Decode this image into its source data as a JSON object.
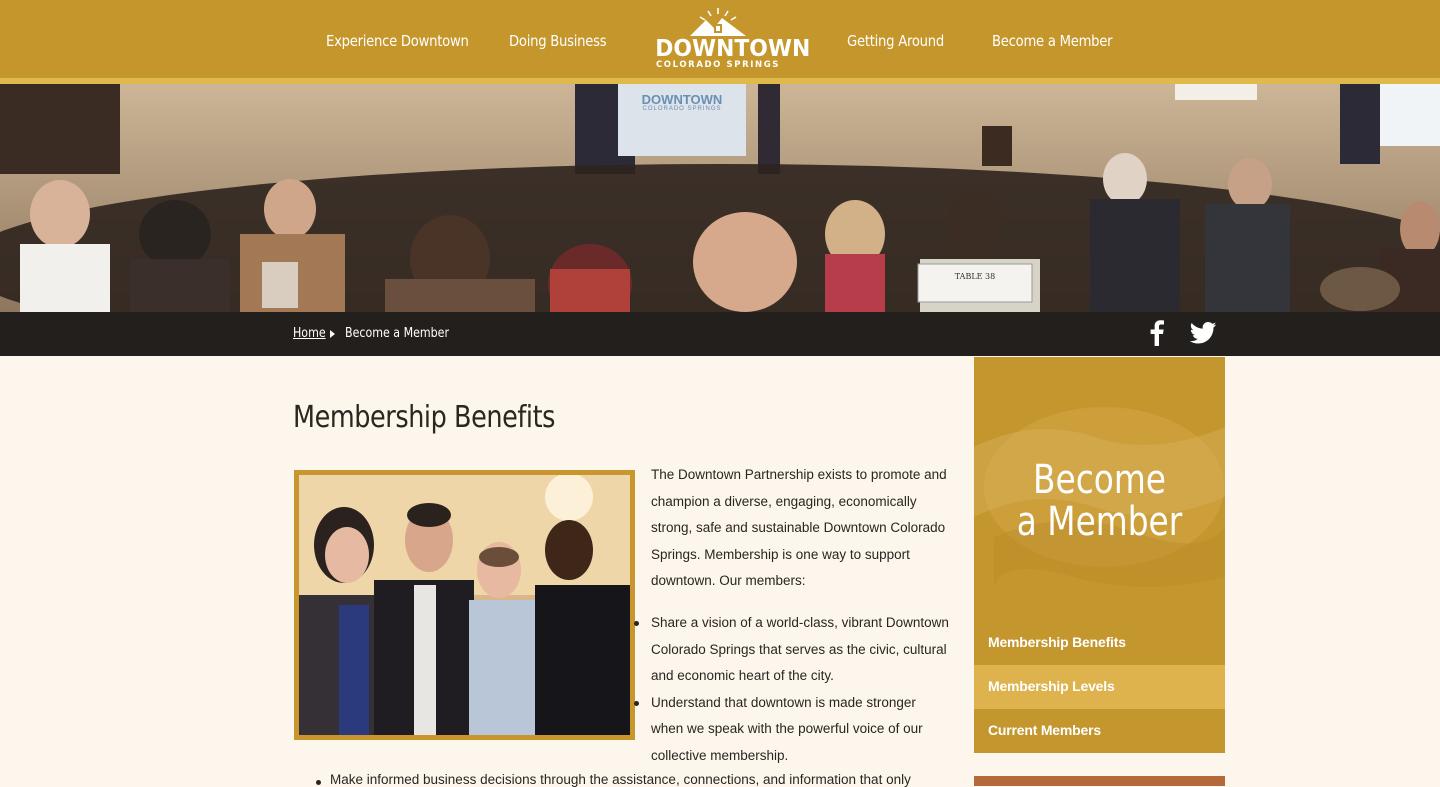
{
  "nav": {
    "left": [
      "Experience Downtown",
      "Doing Business"
    ],
    "right": [
      "Getting Around",
      "Become a Member"
    ],
    "logo_main": "DOWNTOWN",
    "logo_sub": "COLORADO SPRINGS"
  },
  "hero": {
    "screen_text_1": "DOWNTOWN",
    "screen_text_2": "COLORADO SPRINGS",
    "table_card": "TABLE 38"
  },
  "breadcrumb": {
    "home": "Home",
    "current": "Become a Member"
  },
  "social": [
    "facebook-icon",
    "twitter-icon"
  ],
  "main": {
    "title": "Membership Benefits",
    "intro": "The Downtown Partnership exists to promote and champion a diverse, engaging, economically strong, safe and sustainable Downtown Colorado Springs. Membership is one way to support downtown. Our members:",
    "bullets": [
      "Share a vision of a world-class, vibrant Downtown Colorado Springs that serves as the civic, cultural and economic heart of the city.",
      "Understand that downtown is made stronger when we speak with the powerful voice of our collective membership."
    ],
    "bullet_partial": "Make informed business decisions through the assistance, connections, and information that only"
  },
  "sidebar": {
    "title_line1": "Become",
    "title_line2": "a Member",
    "items": [
      {
        "label": "Membership Benefits",
        "bg": "#c4962e"
      },
      {
        "label": "Membership Levels",
        "bg": "#deb24d"
      },
      {
        "label": "Current Members",
        "bg": "#c4962e"
      }
    ]
  },
  "colors": {
    "brand_gold": "#c5962b",
    "light_gold": "#deb24d",
    "dark_bar": "#231f1c",
    "page_bg": "#fcf6ec"
  }
}
